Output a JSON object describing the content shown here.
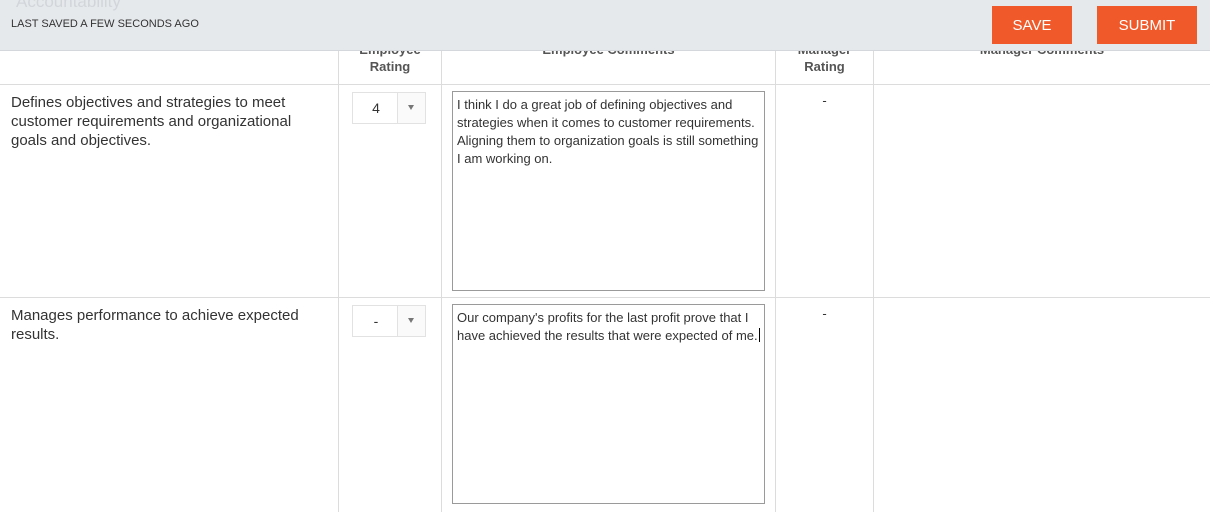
{
  "header": {
    "section_title": "Accountability",
    "saved_status": "LAST SAVED A FEW SECONDS AGO",
    "save_label": "SAVE",
    "submit_label": "SUBMIT"
  },
  "columns": {
    "employee_rating": [
      "Employee",
      "Rating"
    ],
    "employee_comments": "Employee Comments",
    "manager_rating": [
      "Manager",
      "Rating"
    ],
    "manager_comments": "Manager Comments"
  },
  "rows": [
    {
      "competency": "Defines objectives and strategies to meet customer requirements and organizational goals and objectives.",
      "employee_rating": "4",
      "employee_comment": "I think I do a great job of defining objectives and strategies when it comes to customer requirements. Aligning them to organization goals is still something I am working on.",
      "manager_rating": "-",
      "manager_comment": ""
    },
    {
      "competency": "Manages performance to achieve expected results.",
      "employee_rating": "-",
      "employee_comment": "Our company's profits for the last profit prove that I have achieved the results that were expected of me.",
      "manager_rating": "-",
      "manager_comment": ""
    }
  ],
  "colors": {
    "accent": "#f05a2b",
    "topbar": "#e6e9ec",
    "grid": "#dcdcdc"
  }
}
